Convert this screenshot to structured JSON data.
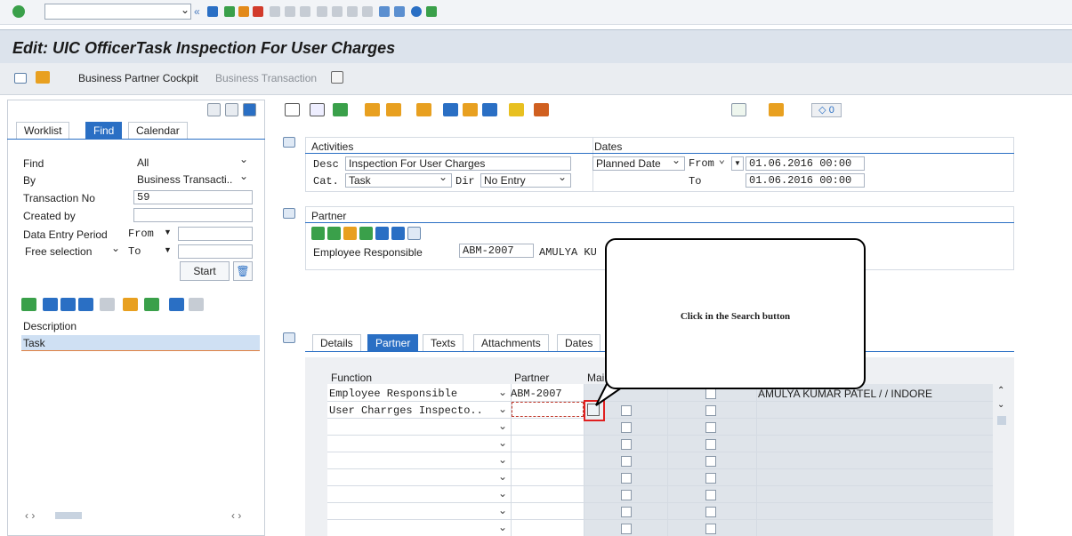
{
  "title": "Edit: UIC OfficerTask Inspection For User Charges",
  "menu": {
    "cockpit": "Business Partner Cockpit",
    "transaction": "Business Transaction"
  },
  "left": {
    "tabs": [
      "Worklist",
      "Find",
      "Calendar"
    ],
    "find_label": "Find",
    "find_value": "All",
    "by_label": "By",
    "by_value": "Business Transacti..",
    "txn_label": "Transaction No",
    "txn_value": "59",
    "created_label": "Created by",
    "period_label": "Data Entry Period",
    "period_from": "From",
    "free_label": "Free selection",
    "free_to": "To",
    "start": "Start",
    "desc_header": "Description",
    "task_row": "Task"
  },
  "toolbar": {
    "count": "0"
  },
  "activities": {
    "title": "Activities",
    "desc_label": "Desc",
    "desc_value": "Inspection For User Charges",
    "cat_label": "Cat.",
    "cat_value": "Task",
    "dir_label": "Dir",
    "dir_value": "No Entry"
  },
  "dates": {
    "title": "Dates",
    "type": "Planned Date",
    "from": "From",
    "to": "To",
    "from_value": "01.06.2016 00:00",
    "to_value": "01.06.2016 00:00"
  },
  "partner": {
    "title": "Partner",
    "role": "Employee Responsible",
    "id": "ABM-2007",
    "name": "AMULYA KU"
  },
  "detail_tabs": [
    "Details",
    "Partner",
    "Texts",
    "Attachments",
    "Dates"
  ],
  "table": {
    "col_function": "Function",
    "col_partner": "Partner",
    "col_main": "Mai",
    "row1_fn": "Employee Responsible",
    "row1_partner": "ABM-2007",
    "row1_name": "AMULYA KUMAR PATEL / / INDORE",
    "row2_fn": "User Charrges Inspecto.."
  },
  "callout": "Click in the Search button",
  "colors": {
    "title_bar": "#dce3ec",
    "accent": "#2a6fc4",
    "highlight": "#cfe0f3",
    "callout_border": "#000000",
    "search_box": "#e02020"
  }
}
